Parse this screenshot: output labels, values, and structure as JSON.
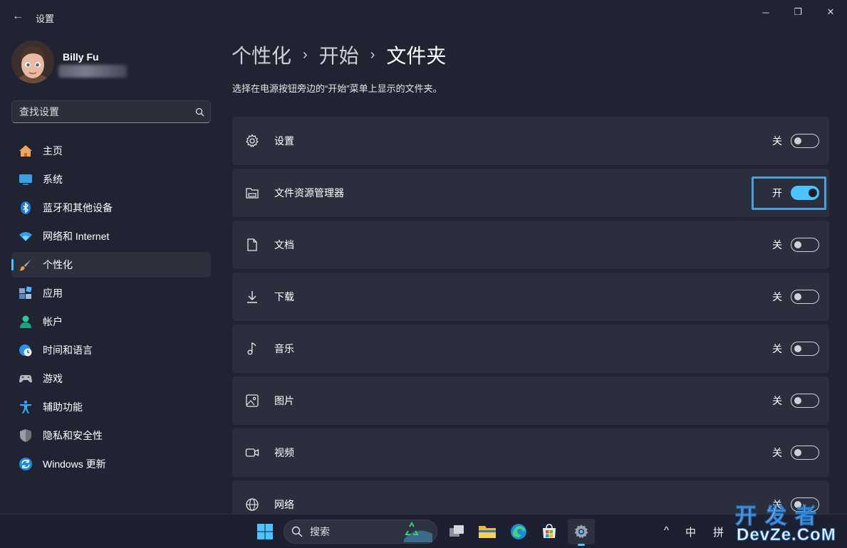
{
  "window": {
    "title": "设置",
    "back_glyph": "←",
    "minimize_glyph": "─",
    "maximize_glyph": "❐",
    "close_glyph": "✕"
  },
  "user": {
    "name": "Billy Fu"
  },
  "search": {
    "placeholder": "查找设置",
    "icon": "search-icon"
  },
  "nav": [
    {
      "label": "主页",
      "icon": "home-icon",
      "active": false
    },
    {
      "label": "系统",
      "icon": "display-icon",
      "active": false
    },
    {
      "label": "蓝牙和其他设备",
      "icon": "bluetooth-icon",
      "active": false
    },
    {
      "label": "网络和 Internet",
      "icon": "wifi-icon",
      "active": false
    },
    {
      "label": "个性化",
      "icon": "brush-icon",
      "active": true
    },
    {
      "label": "应用",
      "icon": "apps-icon",
      "active": false
    },
    {
      "label": "帐户",
      "icon": "person-icon",
      "active": false
    },
    {
      "label": "时间和语言",
      "icon": "globe-clock-icon",
      "active": false
    },
    {
      "label": "游戏",
      "icon": "gamepad-icon",
      "active": false
    },
    {
      "label": "辅助功能",
      "icon": "accessibility-icon",
      "active": false
    },
    {
      "label": "隐私和安全性",
      "icon": "shield-icon",
      "active": false
    },
    {
      "label": "Windows 更新",
      "icon": "update-icon",
      "active": false
    }
  ],
  "breadcrumb": {
    "items": [
      "个性化",
      "开始",
      "文件夹"
    ],
    "separator": "›"
  },
  "description": "选择在电源按钮旁边的“开始”菜单上显示的文件夹。",
  "folders": [
    {
      "label": "设置",
      "icon": "gear-icon",
      "state_text": "关",
      "on": false
    },
    {
      "label": "文件资源管理器",
      "icon": "file-explorer-icon",
      "state_text": "开",
      "on": true,
      "focused": true
    },
    {
      "label": "文档",
      "icon": "document-icon",
      "state_text": "关",
      "on": false
    },
    {
      "label": "下载",
      "icon": "download-icon",
      "state_text": "关",
      "on": false
    },
    {
      "label": "音乐",
      "icon": "music-note-icon",
      "state_text": "关",
      "on": false
    },
    {
      "label": "图片",
      "icon": "picture-icon",
      "state_text": "关",
      "on": false
    },
    {
      "label": "视频",
      "icon": "video-icon",
      "state_text": "关",
      "on": false
    },
    {
      "label": "网络",
      "icon": "network-globe-icon",
      "state_text": "关",
      "on": false
    }
  ],
  "taskbar": {
    "search_label": "搜索",
    "tray_chevron": "^",
    "ime_mode": "中",
    "ime_type": "拼"
  },
  "watermark": {
    "line1": "开发者",
    "line2": "DevZe.CoM"
  },
  "colors": {
    "accent": "#4cc2ff",
    "focus": "#4e9fd8",
    "background": "#202432",
    "card": "#2b2f3d"
  }
}
